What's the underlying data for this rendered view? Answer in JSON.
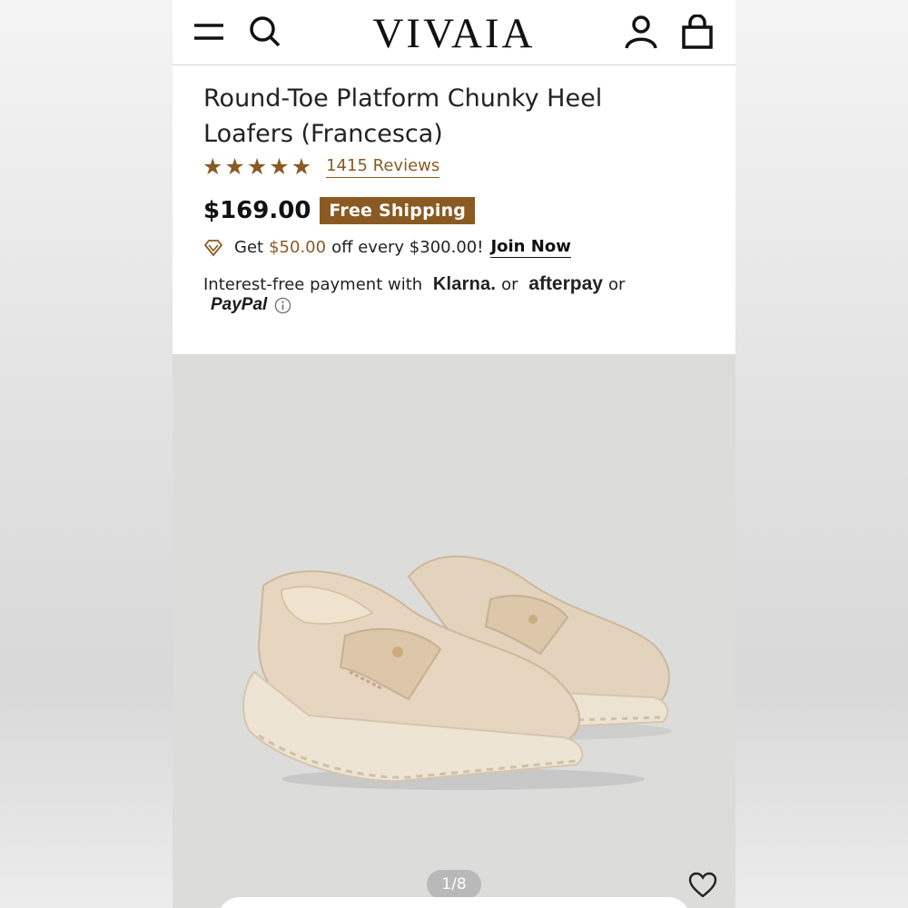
{
  "header": {
    "brand": "VIVAIA",
    "icons": [
      "menu-icon",
      "search-icon",
      "account-icon",
      "bag-icon"
    ]
  },
  "product": {
    "title_line1": "Round-Toe Platform Chunky Heel",
    "title_line2": "Loafers (Francesca)",
    "rating": 5,
    "reviews_label": "1415 Reviews",
    "price": "$169.00",
    "shipping_badge": "Free Shipping",
    "promo": {
      "prefix": "Get",
      "amount": "$50.00",
      "suffix": "off every $300.00!",
      "cta": "Join Now"
    },
    "payment": {
      "prefix": "Interest-free payment with",
      "klarna": "Klarna.",
      "or1": "or",
      "afterpay": "afterpay",
      "or2": "or",
      "paypal": "PayPal"
    }
  },
  "gallery": {
    "counter": "1/8"
  },
  "colors": {
    "accent": "#8a5a22",
    "gallery_bg": "#dcdcdb",
    "shoe": "#e2cfb6"
  }
}
